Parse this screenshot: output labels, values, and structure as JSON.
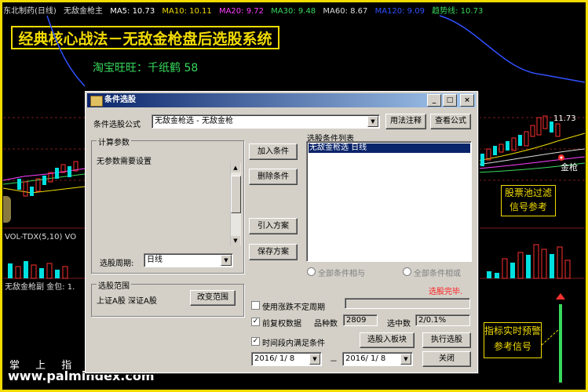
{
  "chart_header": {
    "title": "东北制药(日线)",
    "indicator_name": "无敌金枪主",
    "ma5": "MA5: 10.73",
    "ma10": "MA10: 10.11",
    "ma20": "MA20: 9.72",
    "ma30": "MA30: 9.48",
    "ma60": "MA60: 8.67",
    "ma120": "MA120: 9.09",
    "trend": "趋势线: 10.73"
  },
  "banner": "经典核心战法－无敌金枪盘后选股系统",
  "subtitle": "淘宝旺旺：千纸鹤 58",
  "price_label": "11.73",
  "signal_label": "金枪",
  "note_pool": "股票池过滤信号参考",
  "note_realtime": "指标实时预警参考信号",
  "vol_label": "VOL-TDX(5,10)  VO",
  "sub_label": "无敌金枪副  金包: 1.",
  "watermark_cn": "掌 上 指 标",
  "watermark_url": "www.palmindex.com",
  "colors": {
    "border": "#f2dc00",
    "up": "#ff3030",
    "down": "#00e0e0",
    "green": "#38d95d"
  },
  "dialog": {
    "title": "条件选股",
    "min_btn": "_",
    "max_btn": "□",
    "close_btn": "×",
    "formula_label": "条件选股公式",
    "formula_value": "无敌金枪选   - 无敌金枪",
    "usage_btn": "用法注释",
    "view_formula_btn": "查看公式",
    "params_group": "计算参数",
    "params_text": "无参数需要设置",
    "period_label": "选股周期:",
    "period_value": "日线",
    "add_btn": "加入条件",
    "delete_btn": "删除条件",
    "import_btn": "引入方案",
    "save_btn": "保存方案",
    "list_label": "选股条件列表",
    "list_items": [
      "无敌金枪选   日线"
    ],
    "radio_and": "全部条件相与",
    "radio_or": "全部条件相或",
    "scope_group": "选股范围",
    "scope_text": "上证A股  深证A股",
    "change_scope_btn": "改变范围",
    "done_text": "选股完毕.",
    "chk_uncertain": "使用涨跌不定周期",
    "chk_restore": "前复权数据",
    "count_label": "品种数",
    "count_value": "2809",
    "hit_label": "选中数",
    "hit_value": "2/0.1%",
    "chk_period": "时间段内满足条件",
    "to_block_btn": "选股入板块",
    "run_btn": "执行选股",
    "date_from": "2016/ 1/ 8",
    "date_sep": "－",
    "date_to": "2016/ 1/ 8",
    "close_label": "关闭"
  }
}
